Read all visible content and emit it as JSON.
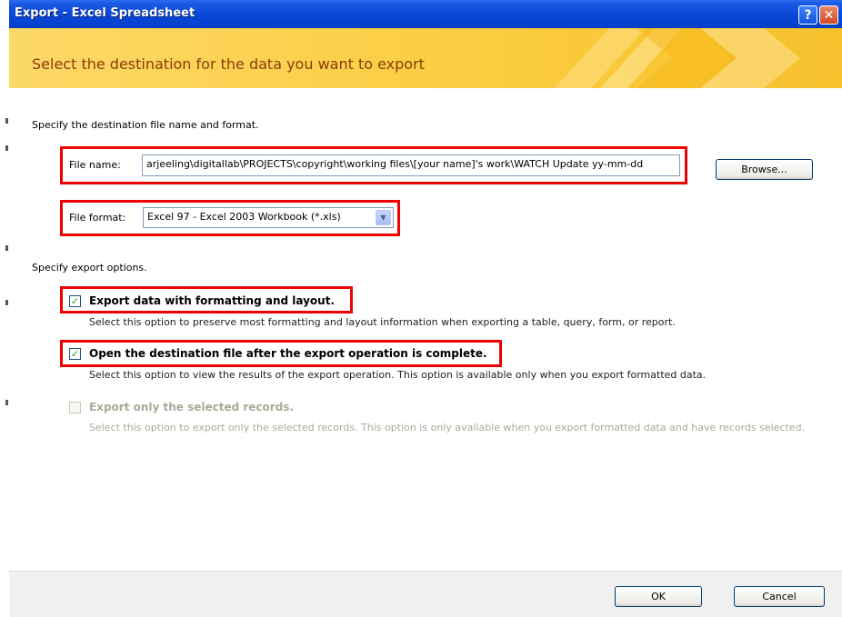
{
  "window": {
    "title": "Export - Excel Spreadsheet",
    "help_glyph": "?",
    "close_glyph": "✕"
  },
  "banner": {
    "heading": "Select the destination for the data you want to export"
  },
  "destination": {
    "instruction": "Specify the destination file name and format.",
    "file_name_label": "File name:",
    "file_name_value": "arjeeling\\digitallab\\PROJECTS\\copyright\\working files\\[your name]'s work\\WATCH Update yy-mm-dd",
    "browse_label": "Browse...",
    "file_format_label": "File format:",
    "file_format_value": "Excel 97 - Excel 2003 Workbook (*.xls)",
    "dropdown_glyph": "▼"
  },
  "options": {
    "instruction": "Specify export options.",
    "check_glyph": "✓",
    "items": [
      {
        "label": "Export data with formatting and layout.",
        "description": "Select this option to preserve most formatting and layout information when exporting a table, query, form, or report.",
        "checked": true,
        "enabled": true
      },
      {
        "label": "Open the destination file after the export operation is complete.",
        "description": "Select this option to view the results of the export operation. This option is available only when you export formatted data.",
        "checked": true,
        "enabled": true
      },
      {
        "label": "Export only the selected records.",
        "description": "Select this option to export only the selected records. This option is only available when you export formatted data and have records selected.",
        "checked": false,
        "enabled": false
      }
    ]
  },
  "footer": {
    "ok_label": "OK",
    "cancel_label": "Cancel"
  },
  "colors": {
    "title_bar": "#0a48d8",
    "banner": "#fbcf47",
    "highlight": "#ee0000"
  }
}
